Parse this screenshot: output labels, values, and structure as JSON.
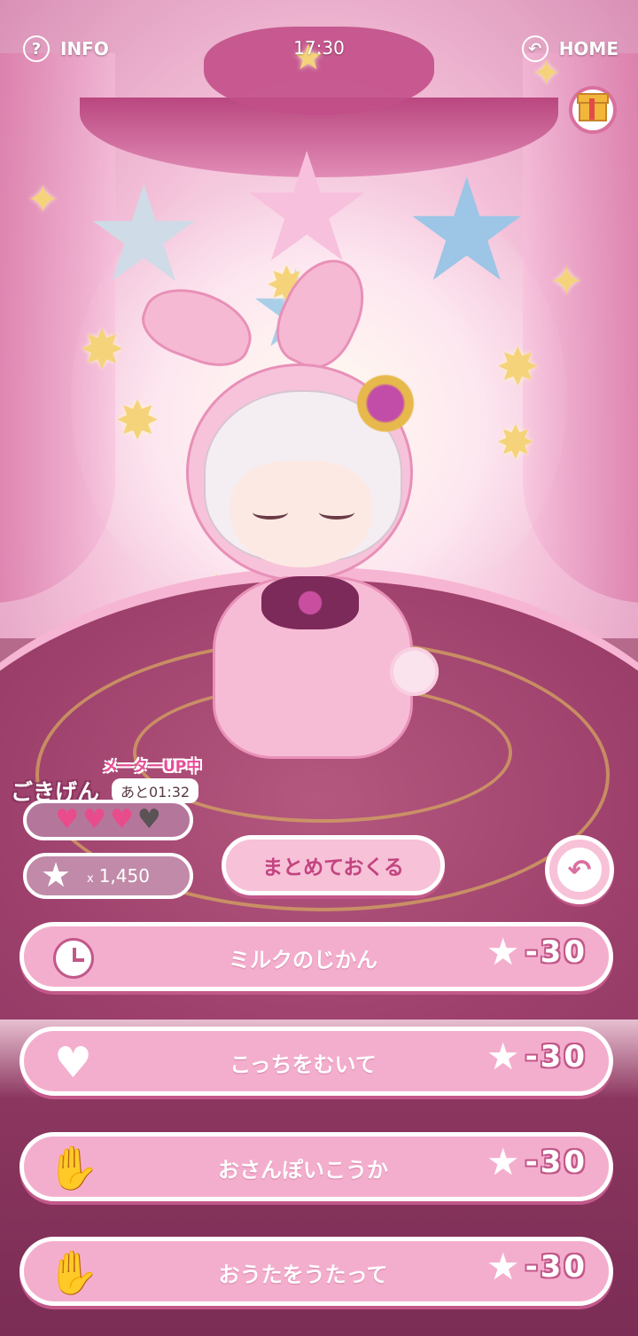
{
  "topbar": {
    "info_label": "INFO",
    "info_icon": "question-icon",
    "time": "17:30",
    "home_label": "HOME",
    "home_icon": "return-icon"
  },
  "gift": {
    "icon": "gift-icon"
  },
  "mood": {
    "meter_up": "メーターUP中",
    "label": "ごきげん",
    "timer": "あと01:32",
    "hearts_filled": 3,
    "hearts_total": 4,
    "colors": {
      "filled": "#e84c8b",
      "empty": "#5a5255"
    }
  },
  "stars": {
    "prefix": "x",
    "count": "1,450"
  },
  "send_all": {
    "label": "まとめておくる"
  },
  "actions": [
    {
      "icon": "clock-icon",
      "label": "ミルクのじかん",
      "cost": "-30"
    },
    {
      "icon": "heart-icon",
      "label": "こっちをむいて",
      "cost": "-30"
    },
    {
      "icon": "clap-hands-icon",
      "label": "おさんぽいこうか",
      "cost": "-30"
    },
    {
      "icon": "clap-hands-icon",
      "label": "おうたをうたって",
      "cost": "-30"
    }
  ],
  "theme": {
    "accent": "#c2447f",
    "button_bg": "#f4aecd"
  }
}
